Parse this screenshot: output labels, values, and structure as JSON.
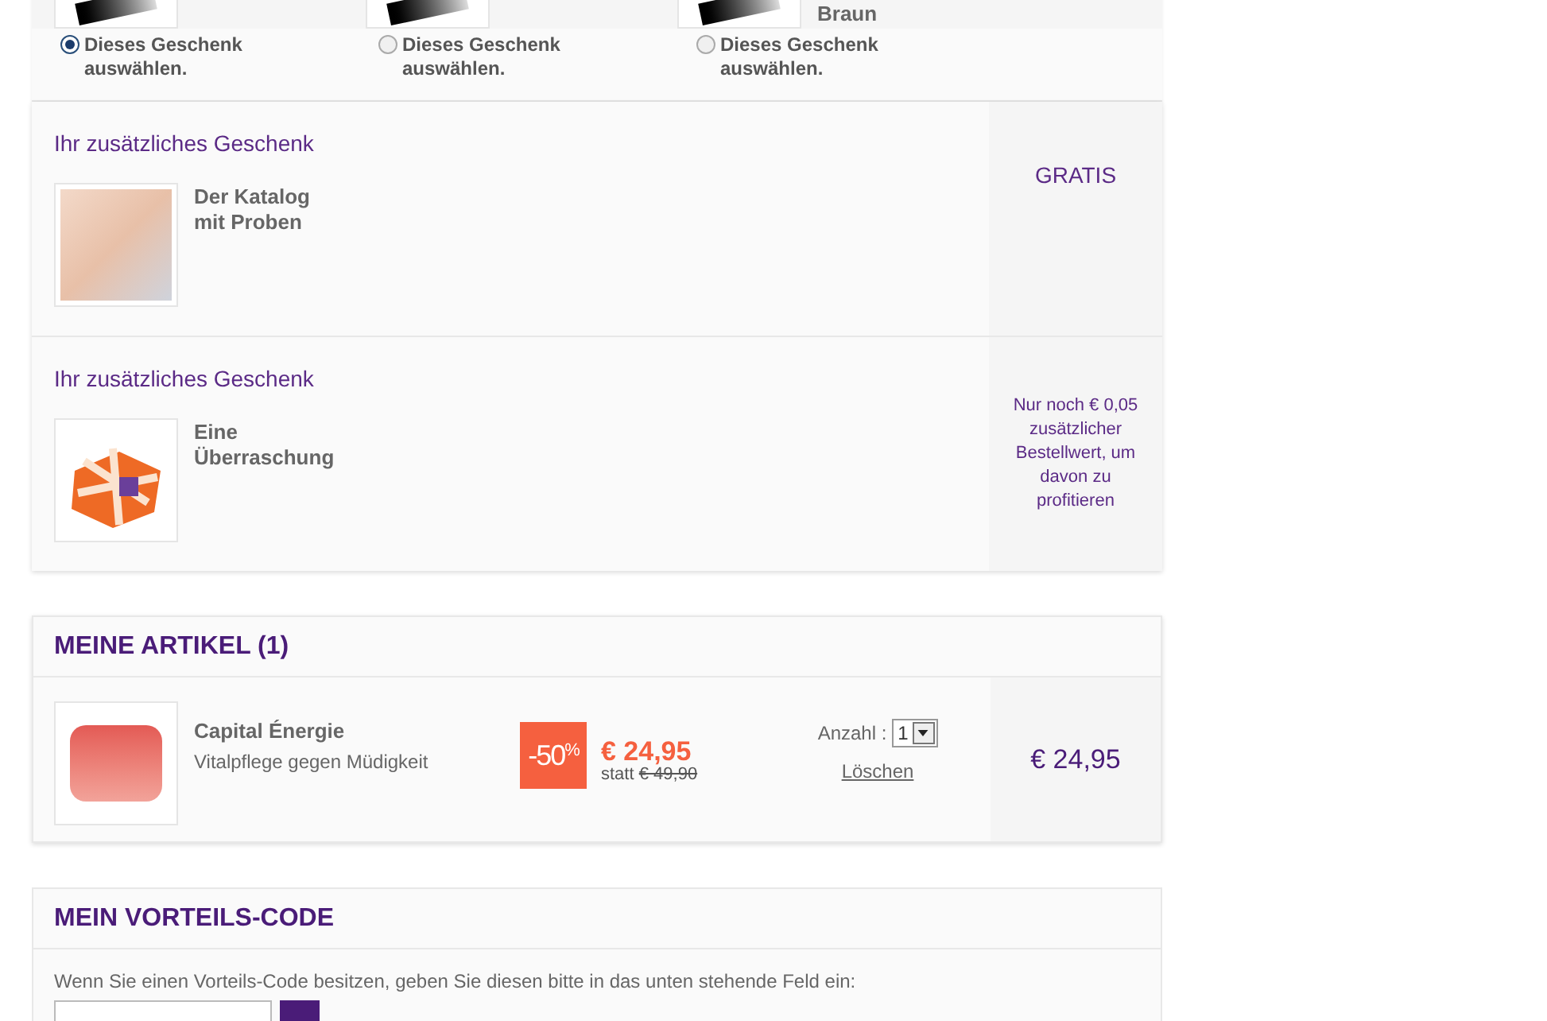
{
  "gift_choices": [
    {
      "selected": true,
      "label": "Dieses Geschenk auswählen."
    },
    {
      "selected": false,
      "label": "Dieses Geschenk auswählen."
    },
    {
      "name": "Braun",
      "selected": false,
      "label": "Dieses Geschenk auswählen."
    }
  ],
  "extra_gifts": [
    {
      "kind": "catalog",
      "heading": "Ihr zusätzliches Geschenk",
      "title": "Der Katalog mit Proben",
      "price_note": "GRATIS"
    },
    {
      "kind": "present",
      "heading": "Ihr zusätzliches Geschenk",
      "title": "Eine Überraschung",
      "price_note": "Nur noch € 0,05 zusätzlicher Bestellwert, um davon zu profitieren"
    }
  ],
  "articles": {
    "title": "MEINE ARTIKEL (1)",
    "items": [
      {
        "name": "Capital Énergie",
        "subtitle": "Vitalpflege gegen Müdigkeit",
        "discount": "-50",
        "discount_unit": "%",
        "price": "€ 24,95",
        "was_label": "statt",
        "was_price": "€ 49,90",
        "qty_label": "Anzahl :",
        "qty": "1",
        "delete": "Löschen",
        "total": "€ 24,95"
      }
    ]
  },
  "voucher": {
    "title": "MEIN VORTEILS-CODE",
    "hint": "Wenn Sie einen Vorteils-Code besitzen, geben Sie diesen bitte in das unten stehende Feld ein:"
  }
}
